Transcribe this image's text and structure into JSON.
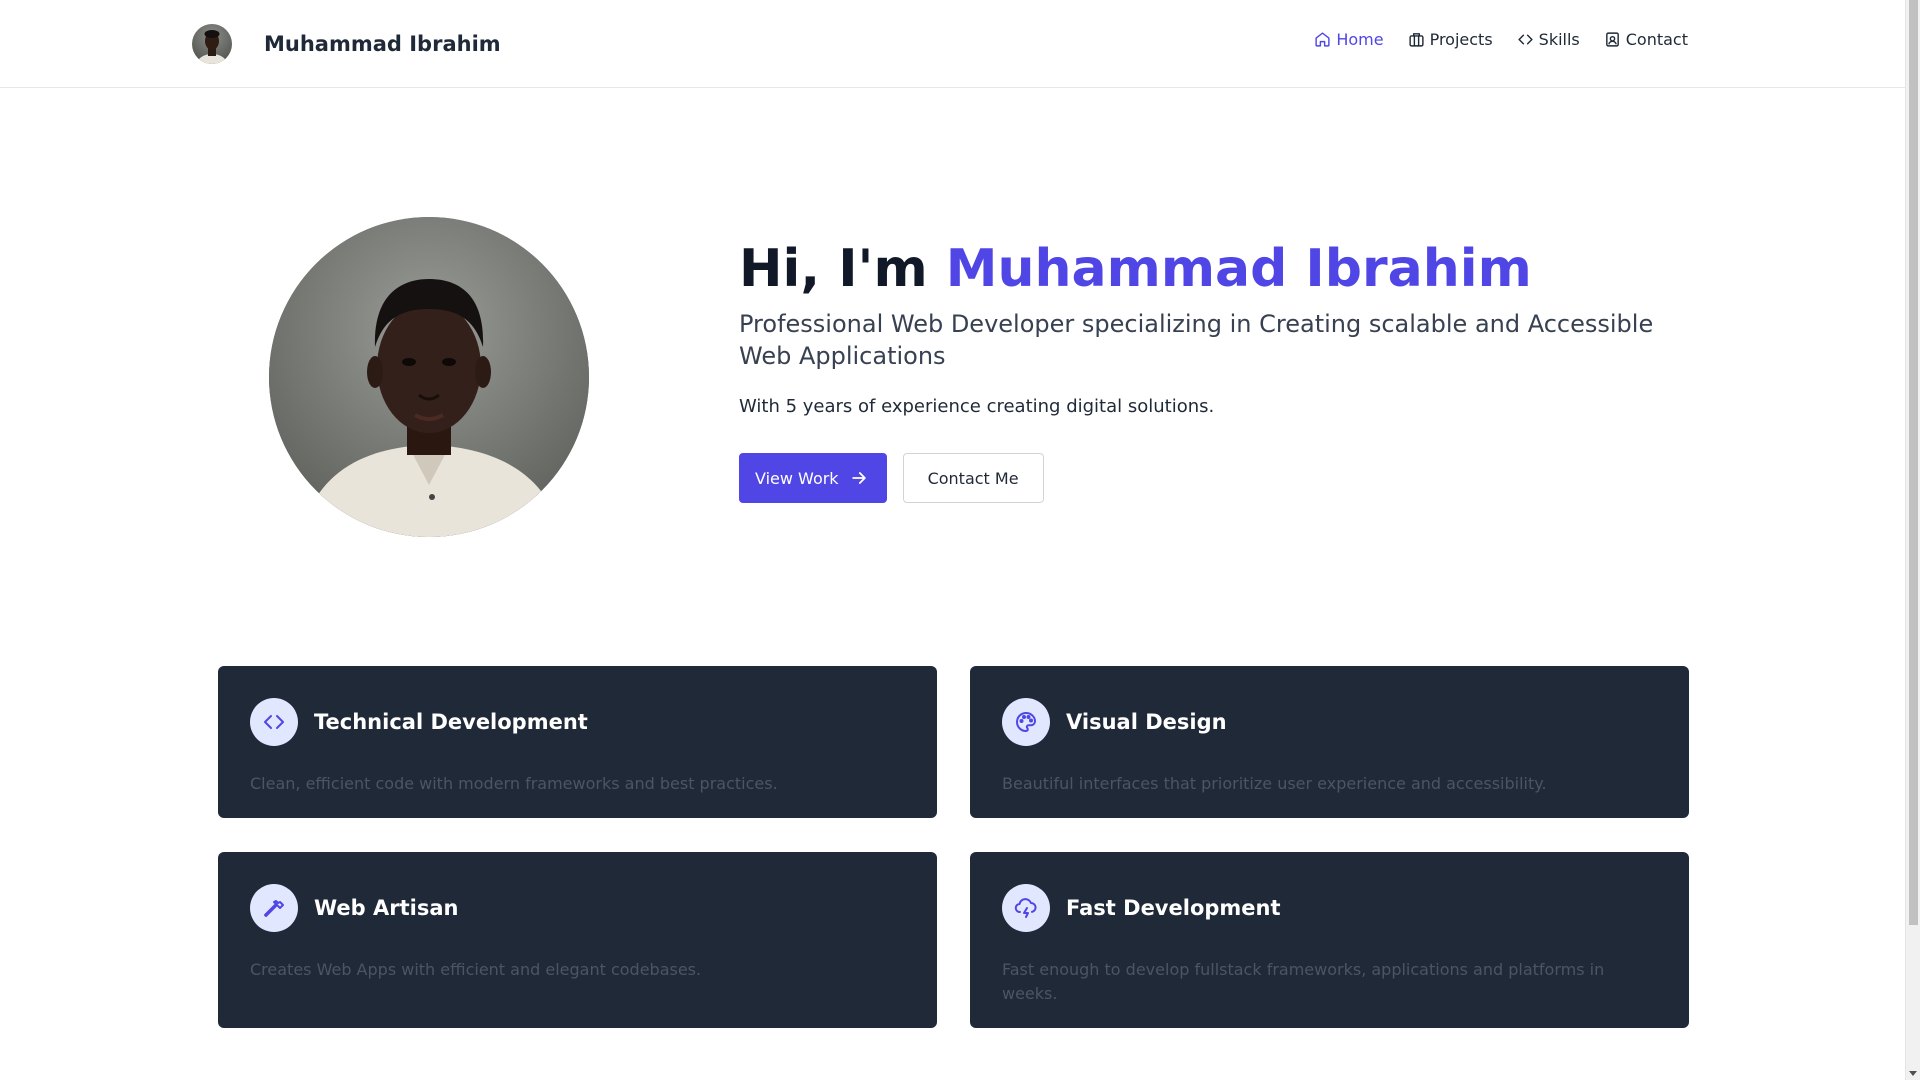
{
  "header": {
    "brand_name": "Muhammad Ibrahim",
    "nav": [
      {
        "label": "Home",
        "icon": "home-icon",
        "active": true
      },
      {
        "label": "Projects",
        "icon": "briefcase-icon",
        "active": false
      },
      {
        "label": "Skills",
        "icon": "code-icon",
        "active": false
      },
      {
        "label": "Contact",
        "icon": "contact-icon",
        "active": false
      }
    ]
  },
  "hero": {
    "greeting": "Hi, I'm ",
    "name": "Muhammad Ibrahim",
    "subtitle": "Professional Web Developer specializing in Creating scalable and Accessible Web Applications",
    "experience": "With 5 years of experience creating digital solutions.",
    "primary_button": "View Work",
    "secondary_button": "Contact Me"
  },
  "cards": [
    {
      "title": "Technical Development",
      "description": "Clean, efficient code with modern frameworks and best practices.",
      "icon": "code-icon"
    },
    {
      "title": "Visual Design",
      "description": "Beautiful interfaces that prioritize user experience and accessibility.",
      "icon": "palette-icon"
    },
    {
      "title": "Web Artisan",
      "description": "Creates Web Apps with efficient and elegant codebases.",
      "icon": "hammer-icon"
    },
    {
      "title": "Fast Development",
      "description": "Fast enough to develop fullstack frameworks, applications and platforms in weeks.",
      "icon": "cloud-lightning-icon"
    }
  ],
  "colors": {
    "accent": "#4f46e5",
    "card_bg": "#1f2937",
    "icon_bg": "#e0e7ff"
  }
}
